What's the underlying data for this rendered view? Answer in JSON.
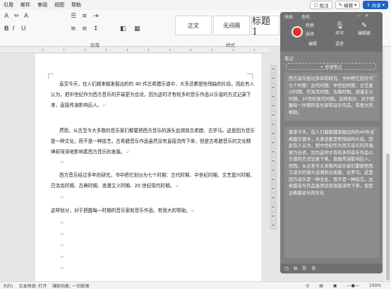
{
  "menubar": {
    "items": [
      "引用",
      "邮件",
      "审阅",
      "视图",
      "帮助"
    ],
    "comment_label": "批注",
    "edit_label": "编辑",
    "share_label": "共享"
  },
  "ribbon": {
    "styles": [
      "正文",
      "无间隔",
      "标题 1"
    ],
    "groups": [
      "段落",
      "样式"
    ],
    "font_label": "A"
  },
  "document": {
    "paragraphs": [
      "直至今天，在人们越来越发掘出的约 40 件古希腊乐谱中，大多还都是些残缺的片段。因此有人认为，把中世纪作为西方音乐的开端更为合适，因为这时才有较多的音乐作品以乐谱的方式记录下来，直接传演影响后人。",
      "然而，从古至今大多数的音乐家们都要把西方音乐的源头追溯到古希腊、古罗马。这是因为音乐是一种文化，而不是一种技艺。古希腊音乐作品虽然没有直接流传下来，但是古希腊音乐的文化精神却深深地影响着西方音乐的发展。",
      "西方音乐经过多年的研究，书中把它划分为七个时期：古代时期、中世纪时期、文艺复兴时期、巴洛克时期、古典时期、浪漫主义时期、20 世纪现代时期。",
      "这样划分，对于把握每一时期的音乐家和音乐作品，有很大的帮助。"
    ],
    "para_mark": "↵"
  },
  "panel": {
    "tab_labels": [
      "收纳",
      "查找"
    ],
    "buttons": [
      "转换",
      "选择",
      "编辑",
      "听写",
      "语音",
      "编辑器"
    ],
    "notes_header": "笔记",
    "add_note_label": "+ 新增笔记",
    "notes": [
      "西方音乐经过多年的研究，书中把它划分为七个时期：古代时期、中世纪时期、文艺复兴时期、巴洛克时期、古典时期、浪漫主义时期、20世纪现代时期。这样划分，对于把握每一时期的音乐家和音乐作品，有很大的帮助。",
      "直至今天，在人们越来越发掘出的约40件古希腊乐谱中，大多还都是些残缺的片段。因此有人认为，把中世纪作为西方音乐的开端更为合适，因为这时才有较多的音乐作品以乐谱的方式记录下来，直接传演影响后人。然而，从古至今大多数的音乐家们都要把西方音乐的源头追溯到古希腊、古罗马。这是因为音乐是一种文化，而不是一种技艺。古希腊音乐作品虽然没有直接流传下来，但是古希腊音乐的文化"
    ]
  },
  "statusbar": {
    "items": [
      "大约)",
      "文本预测: 打开",
      "辅助功能: 一切就绪"
    ],
    "zoom": "100%"
  }
}
